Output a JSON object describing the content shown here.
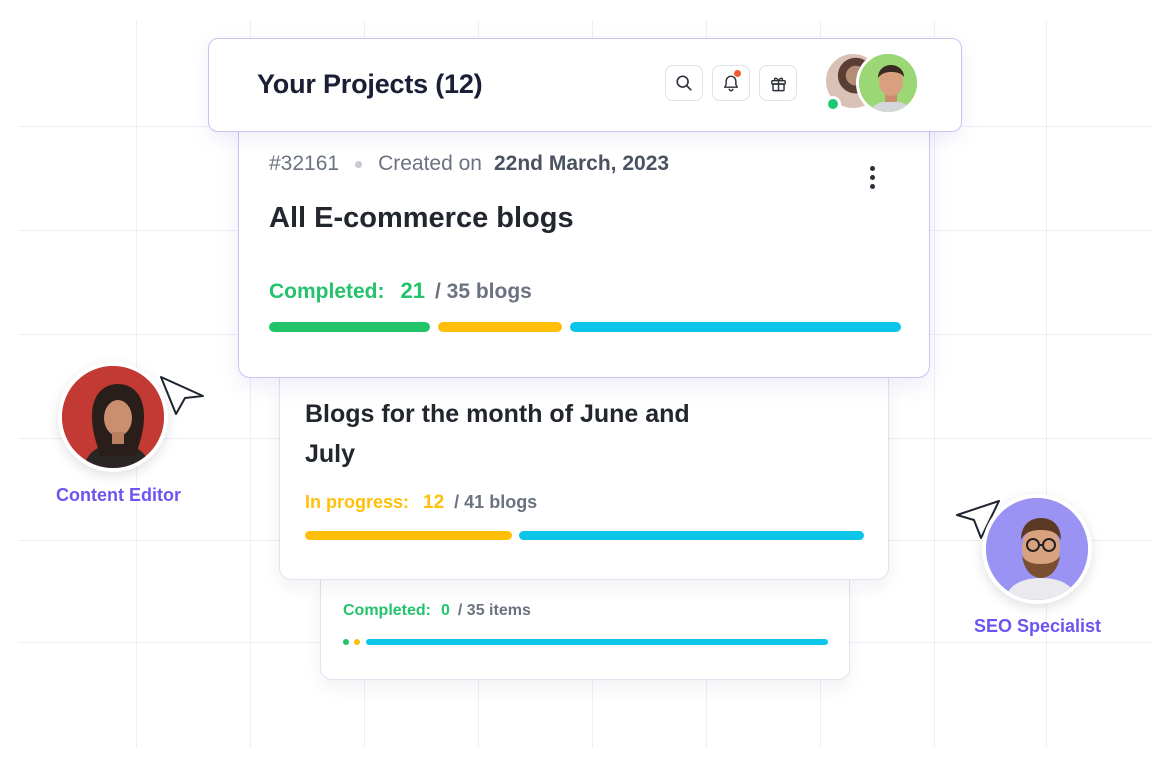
{
  "header": {
    "title": "Your Projects (12)",
    "icons": [
      "search-icon",
      "bell-icon",
      "gift-icon"
    ],
    "user_online": true
  },
  "projects": [
    {
      "id": "#32161",
      "created_label": "Created on",
      "created_date": "22nd March, 2023",
      "title": "All E-commerce blogs",
      "status_label": "Completed:",
      "count": "21",
      "total": "/ 35 blogs",
      "progress": [
        {
          "color": "#22c36b",
          "fraction": 0.258
        },
        {
          "color": "#ffbf0a",
          "fraction": 0.198
        },
        {
          "color": "#0cc5e8",
          "fraction": 0.53
        }
      ]
    },
    {
      "title": "Blogs for the month of June and July",
      "status_label": "In progress:",
      "count": "12",
      "total": "/ 41 blogs",
      "progress": [
        {
          "color": "#ffbf0a",
          "fraction": 0.38
        },
        {
          "color": "#0cc5e8",
          "fraction": 0.62
        }
      ]
    },
    {
      "status_label": "Completed:",
      "count": "0",
      "total": "/ 35 items",
      "progress": [
        {
          "color": "#22c36b",
          "fraction": 0.01
        },
        {
          "color": "#ffbf0a",
          "fraction": 0.01
        },
        {
          "color": "#0cc5e8",
          "fraction": 0.98
        }
      ]
    }
  ],
  "personas": [
    {
      "label": "Content Editor",
      "pointer": "cursor-arrow-icon"
    },
    {
      "label": "SEO Specialist",
      "pointer": "cursor-arrow-icon"
    }
  ],
  "colors": {
    "accent": "#6b55f0",
    "completed": "#22c36b",
    "in_progress": "#ffbf0a",
    "remaining": "#0cc5e8",
    "notification": "#f25a2b"
  }
}
